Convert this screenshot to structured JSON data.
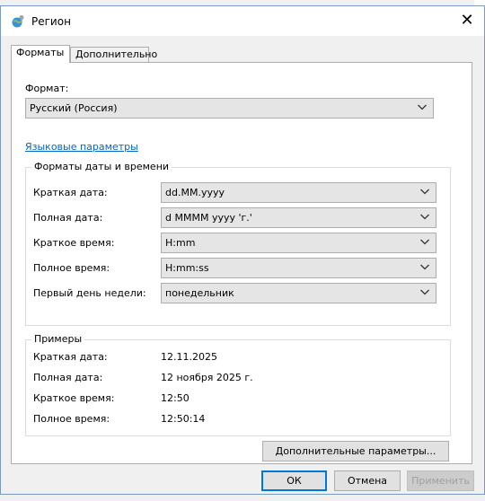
{
  "dialog": {
    "title": "Регион",
    "close_glyph": "✕"
  },
  "tabs": [
    {
      "label": "Форматы",
      "active": true
    },
    {
      "label": "Дополнительно",
      "active": false
    }
  ],
  "format": {
    "label": "Формат:",
    "value": "Русский (Россия)"
  },
  "language_link": "Языковые параметры",
  "datetime_group": {
    "title": "Форматы даты и времени",
    "rows": [
      {
        "label": "Краткая дата:",
        "value": "dd.MM.yyyy"
      },
      {
        "label": "Полная дата:",
        "value": "d MMMM yyyy 'г.'"
      },
      {
        "label": "Краткое время:",
        "value": "H:mm"
      },
      {
        "label": "Полное время:",
        "value": "H:mm:ss"
      },
      {
        "label": "Первый день недели:",
        "value": "понедельник"
      }
    ]
  },
  "examples_group": {
    "title": "Примеры",
    "rows": [
      {
        "label": "Краткая дата:",
        "value": "12.11.2025"
      },
      {
        "label": "Полная дата:",
        "value": "12 ноября 2025 г."
      },
      {
        "label": "Краткое время:",
        "value": "12:50"
      },
      {
        "label": "Полное время:",
        "value": "12:50:14"
      }
    ]
  },
  "buttons": {
    "additional": "Дополнительные параметры...",
    "ok": "ОК",
    "cancel": "Отмена",
    "apply": "Применить"
  },
  "background": {
    "right_fragment": "ı"
  },
  "colors": {
    "accent": "#0078d7",
    "link": "#0066cc"
  }
}
